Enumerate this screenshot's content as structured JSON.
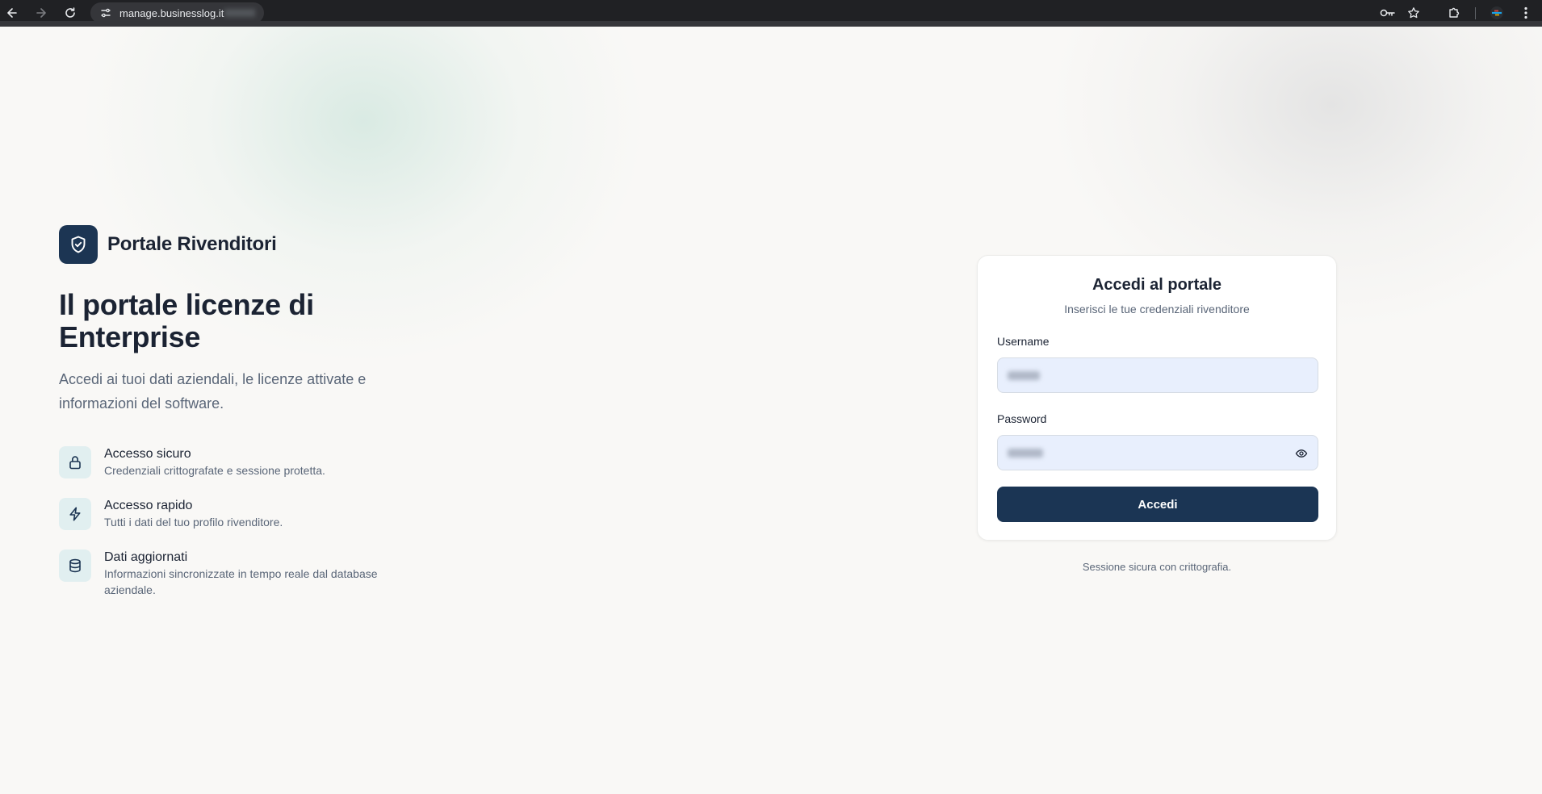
{
  "browser": {
    "url": "manage.businesslog.it",
    "icons": [
      "back-arrow-icon",
      "forward-arrow-icon",
      "reload-icon",
      "site-info-icon",
      "password-key-icon",
      "bookmark-star-icon",
      "extensions-icon",
      "profile-avatar-icon",
      "menu-kebab-icon"
    ]
  },
  "brand": {
    "name": "Portale Rivenditori",
    "icon": "shield-check-icon"
  },
  "hero": {
    "title": "Il portale licenze di Enterprise",
    "subtitle": "Accedi ai tuoi dati aziendali, le licenze attivate e informazioni del software."
  },
  "features": [
    {
      "icon": "lock-icon",
      "title": "Accesso sicuro",
      "description": "Credenziali crittografate e sessione protetta."
    },
    {
      "icon": "lightning-icon",
      "title": "Accesso rapido",
      "description": "Tutti i dati del tuo profilo rivenditore."
    },
    {
      "icon": "database-icon",
      "title": "Dati aggiornati",
      "description": "Informazioni sincronizzate in tempo reale dal database aziendale."
    }
  ],
  "login": {
    "title": "Accedi al portale",
    "subtitle": "Inserisci le tue credenziali rivenditore",
    "username_label": "Username",
    "password_label": "Password",
    "submit_label": "Accedi",
    "secure_note": "Sessione sicura con crittografia."
  },
  "colors": {
    "brand": "#1c3553",
    "button": "#1b3554",
    "input_fill": "#e8effd",
    "feature_icon_bg": "#e1eff0",
    "page_bg": "#f9f8f6"
  }
}
